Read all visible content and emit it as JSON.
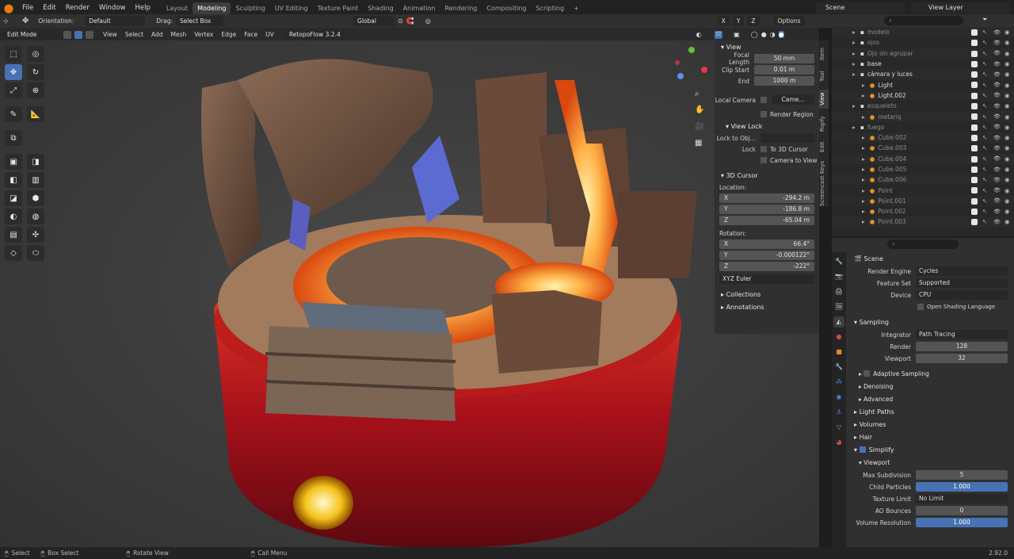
{
  "menus": [
    "File",
    "Edit",
    "Render",
    "Window",
    "Help"
  ],
  "workspaces": [
    "Layout",
    "Modeling",
    "Sculpting",
    "UV Editing",
    "Texture Paint",
    "Shading",
    "Animation",
    "Rendering",
    "Compositing",
    "Scripting"
  ],
  "active_workspace": "Modeling",
  "scene_name": "Scene",
  "view_layer": "View Layer",
  "options_label": "Options",
  "header": {
    "orientation_label": "Orientation:",
    "orientation_value": "Default",
    "drag_label": "Drag:",
    "drag_value": "Select Box",
    "transform_orientation": "Global",
    "axes": [
      "X",
      "Y",
      "Z"
    ]
  },
  "viewport_header": {
    "mode": "Edit Mode",
    "menus": [
      "View",
      "Select",
      "Add",
      "Mesh",
      "Vertex",
      "Edge",
      "Face",
      "UV"
    ],
    "addon": "RetopoFlow 3.2.4"
  },
  "side_tabs": [
    "Item",
    "Tool",
    "View",
    "Rigify",
    "Edit",
    "Screencast Keys"
  ],
  "npanel": {
    "view_title": "View",
    "focal_length_label": "Focal Length",
    "focal_length": "50 mm",
    "clip_start_label": "Clip Start",
    "clip_start": "0.01 m",
    "end_label": "End",
    "end": "1000 m",
    "local_camera_label": "Local Camera",
    "local_camera_value": "Came...",
    "render_region": "Render Region",
    "view_lock_title": "View Lock",
    "lock_to_object_label": "Lock to Obj...",
    "lock_label": "Lock",
    "to_3d_cursor": "To 3D Cursor",
    "camera_to_view": "Camera to View",
    "cursor_title": "3D Cursor",
    "location_label": "Location:",
    "loc_x": "-294.2 m",
    "loc_y": "-186.8 m",
    "loc_z": "-65.04 m",
    "rotation_label": "Rotation:",
    "rot_x": "66.4°",
    "rot_y": "-0.000122°",
    "rot_z": "-222°",
    "rotation_mode": "XYZ Euler",
    "collections": "Collections",
    "annotations": "Annotations"
  },
  "outliner": [
    {
      "name": "modelo",
      "indent": 1,
      "dim": true
    },
    {
      "name": "ojos",
      "indent": 1,
      "dim": true
    },
    {
      "name": "Ojo sin agrupar",
      "indent": 1,
      "dim": true
    },
    {
      "name": "base",
      "indent": 1,
      "dim": false
    },
    {
      "name": "cámara y luces",
      "indent": 1,
      "dim": false
    },
    {
      "name": "Light",
      "indent": 2,
      "dim": false
    },
    {
      "name": "Light.002",
      "indent": 2,
      "dim": false
    },
    {
      "name": "esqueleto",
      "indent": 1,
      "dim": true
    },
    {
      "name": "metarig",
      "indent": 2,
      "dim": true
    },
    {
      "name": "fuego",
      "indent": 1,
      "dim": true
    },
    {
      "name": "Cube.002",
      "indent": 2,
      "dim": true
    },
    {
      "name": "Cube.003",
      "indent": 2,
      "dim": true
    },
    {
      "name": "Cube.004",
      "indent": 2,
      "dim": true
    },
    {
      "name": "Cube.005",
      "indent": 2,
      "dim": true
    },
    {
      "name": "Cube.006",
      "indent": 2,
      "dim": true
    },
    {
      "name": "Point",
      "indent": 2,
      "dim": true
    },
    {
      "name": "Point.001",
      "indent": 2,
      "dim": true
    },
    {
      "name": "Point.002",
      "indent": 2,
      "dim": true
    },
    {
      "name": "Point.003",
      "indent": 2,
      "dim": true
    }
  ],
  "properties": {
    "scene": "Scene",
    "render_engine_label": "Render Engine",
    "render_engine": "Cycles",
    "feature_set_label": "Feature Set",
    "feature_set": "Supported",
    "device_label": "Device",
    "device": "CPU",
    "osl": "Open Shading Language",
    "sampling": "Sampling",
    "integrator_label": "Integrator",
    "integrator": "Path Tracing",
    "render_label": "Render",
    "render_samples": "128",
    "viewport_label": "Viewport",
    "viewport_samples": "32",
    "adaptive_sampling": "Adaptive Sampling",
    "denoising": "Denoising",
    "advanced": "Advanced",
    "light_paths": "Light Paths",
    "volumes": "Volumes",
    "hair": "Hair",
    "simplify": "Simplify",
    "viewport_sub": "Viewport",
    "max_subdivision_label": "Max Subdivision",
    "max_subdivision": "5",
    "child_particles_label": "Child Particles",
    "child_particles": "1.000",
    "texture_limit_label": "Texture Limit",
    "texture_limit": "No Limit",
    "ao_bounces_label": "AO Bounces",
    "ao_bounces": "0",
    "volume_resolution_label": "Volume Resolution",
    "volume_resolution": "1.000"
  },
  "status": {
    "select": "Select",
    "box_select": "Box Select",
    "rotate_view": "Rotate View",
    "call_menu": "Call Menu",
    "version": "2.92.0"
  },
  "colors": {
    "accent": "#4772b3",
    "lava": "#ff8a2a",
    "base_red": "#c01818"
  }
}
